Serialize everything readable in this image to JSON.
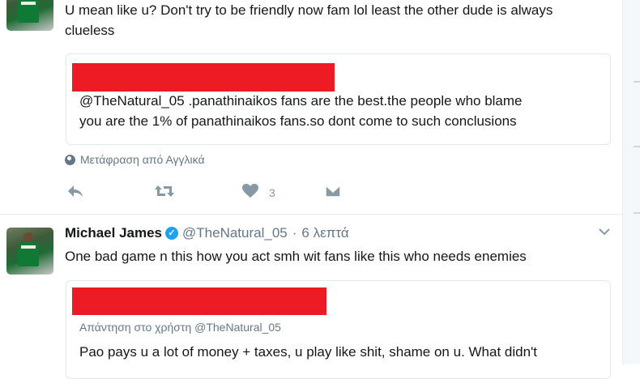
{
  "tweet1": {
    "text": "U mean like u? Don't try to be friendly now fam lol least the other dude is always",
    "text_cont": "clueless",
    "quote": {
      "line1": "@TheNatural_05 .panathinaikos fans are the best.the people who blame",
      "line2": "you are the 1% of panathinaikos fans.so dont come to such conclusions"
    },
    "translate": "Μετάφραση από Αγγλικά",
    "like_count": "3"
  },
  "tweet2": {
    "name": "Michael James",
    "handle": "@TheNatural_05",
    "separator": "·",
    "time": "6 λεπτά",
    "text": "One bad game n this how you act smh wit fans like this who needs enemies",
    "quote": {
      "replying": "Απάντηση στο χρήστη @TheNatural_05",
      "line1": "Pao pays u a lot of money + taxes, u play like shit, shame on u. What didn't"
    }
  },
  "icons": {
    "reply": "reply-icon",
    "retweet": "retweet-icon",
    "like": "heart-icon",
    "dm": "envelope-icon",
    "verified": "verified-badge-icon",
    "more": "chevron-down-icon"
  },
  "colors": {
    "redaction": "#ed1c24",
    "verified": "#1da1f2",
    "muted": "#657786"
  }
}
